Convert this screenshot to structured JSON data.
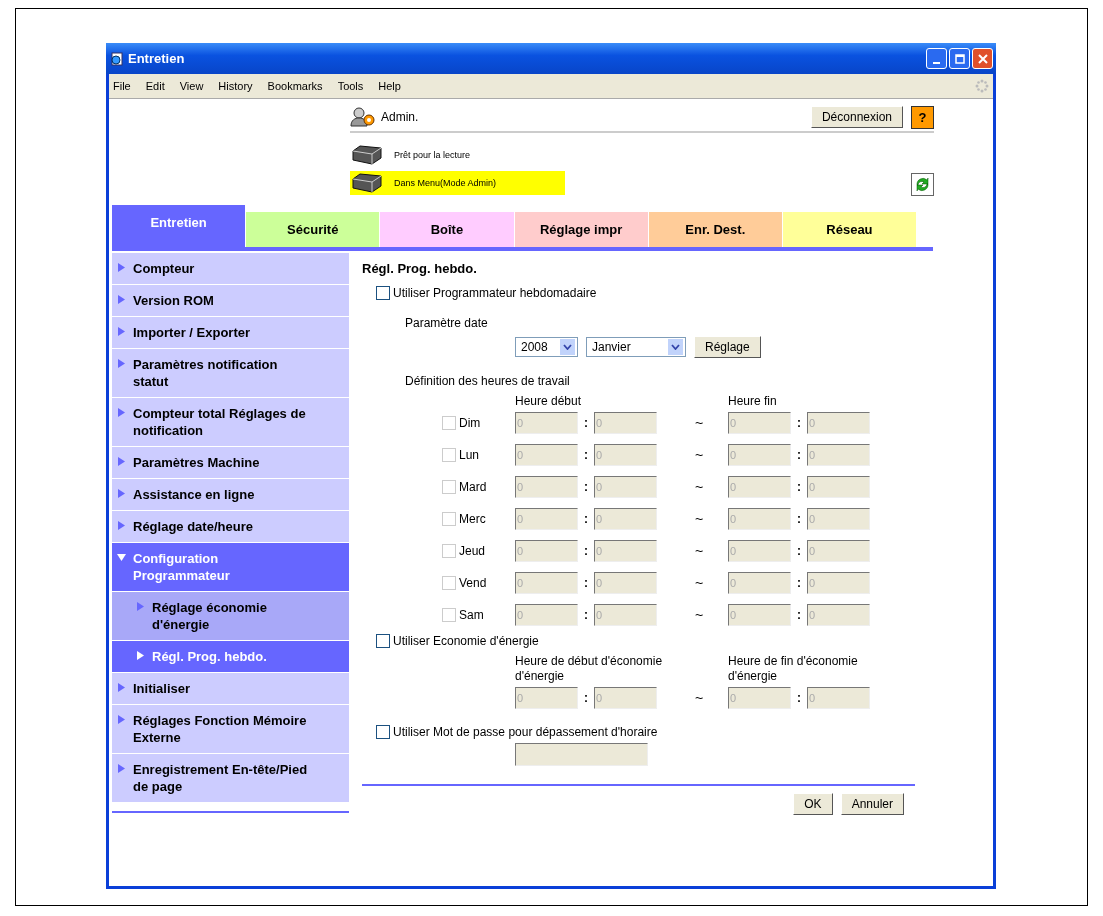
{
  "window": {
    "title": "Entretien"
  },
  "menu": [
    "File",
    "Edit",
    "View",
    "History",
    "Bookmarks",
    "Tools",
    "Help"
  ],
  "header": {
    "user": "Admin.",
    "logout": "Déconnexion",
    "help": "?",
    "status": [
      {
        "text": "Prêt pour la lecture",
        "highlighted": false
      },
      {
        "text": "Dans Menu(Mode Admin)",
        "highlighted": true
      }
    ]
  },
  "tabs": [
    {
      "label": "Entretien",
      "selected": true,
      "color": "#6666ff"
    },
    {
      "label": "Sécurité",
      "selected": false,
      "color": "#ccff99"
    },
    {
      "label": "Boîte",
      "selected": false,
      "color": "#ffccff"
    },
    {
      "label": "Réglage impr",
      "selected": false,
      "color": "#ffcccc"
    },
    {
      "label": "Enr. Dest.",
      "selected": false,
      "color": "#ffcc99"
    },
    {
      "label": "Réseau",
      "selected": false,
      "color": "#ffff99"
    }
  ],
  "sidebar": {
    "items": [
      {
        "label": "Compteur",
        "expanded": false
      },
      {
        "label": "Version ROM",
        "expanded": false
      },
      {
        "label": "Importer / Exporter",
        "expanded": false
      },
      {
        "label": "Paramètres notification statut",
        "expanded": false
      },
      {
        "label": "Compteur total Réglages de notification",
        "expanded": false
      },
      {
        "label": "Paramètres Machine",
        "expanded": false
      },
      {
        "label": "Assistance en ligne",
        "expanded": false
      },
      {
        "label": "Réglage date/heure",
        "expanded": false
      },
      {
        "label": "Configuration Programmateur",
        "expanded": true,
        "children": [
          {
            "label": "Réglage économie d'énergie",
            "selected": false
          },
          {
            "label": "Régl. Prog. hebdo.",
            "selected": true
          }
        ]
      },
      {
        "label": "Initialiser",
        "expanded": false
      },
      {
        "label": "Réglages Fonction Mémoire Externe",
        "expanded": false
      },
      {
        "label": "Enregistrement En-tête/Pied de page",
        "expanded": false
      }
    ]
  },
  "form": {
    "title": "Régl. Prog. hebdo.",
    "weekly": {
      "label": "Utiliser Programmateur hebdomadaire",
      "checked": false
    },
    "date": {
      "label": "Paramètre date",
      "year": "2008",
      "month": "Janvier",
      "button": "Réglage"
    },
    "hours": {
      "label": "Définition des heures de travail",
      "start_header": "Heure début",
      "end_header": "Heure fin",
      "rows": [
        {
          "day": "Dim",
          "checked": false,
          "disabled": true,
          "start_hour": "0",
          "start_minute": "0",
          "end_hour": "0",
          "end_minute": "0",
          "separators": [
            ":",
            "~",
            ":"
          ]
        },
        {
          "day": "Lun",
          "checked": false,
          "disabled": true,
          "start_hour": "0",
          "start_minute": "0",
          "end_hour": "0",
          "end_minute": "0",
          "separators": [
            ":",
            "~",
            ":"
          ]
        },
        {
          "day": "Mard",
          "checked": false,
          "disabled": true,
          "start_hour": "0",
          "start_minute": "0",
          "end_hour": "0",
          "end_minute": "0",
          "separators": [
            ":",
            "~",
            ":"
          ]
        },
        {
          "day": "Merc",
          "checked": false,
          "disabled": true,
          "start_hour": "0",
          "start_minute": "0",
          "end_hour": "0",
          "end_minute": "0",
          "separators": [
            ":",
            "~",
            ":"
          ]
        },
        {
          "day": "Jeud",
          "checked": false,
          "disabled": true,
          "start_hour": "0",
          "start_minute": "0",
          "end_hour": "0",
          "end_minute": "0",
          "separators": [
            ":",
            "~",
            ":"
          ]
        },
        {
          "day": "Vend",
          "checked": false,
          "disabled": true,
          "start_hour": "0",
          "start_minute": "0",
          "end_hour": "0",
          "end_minute": "0",
          "separators": [
            ":",
            "~",
            ":"
          ]
        },
        {
          "day": "Sam",
          "checked": false,
          "disabled": true,
          "start_hour": "0",
          "start_minute": "0",
          "end_hour": "0",
          "end_minute": "0",
          "separators": [
            ":",
            "~",
            ":"
          ]
        }
      ]
    },
    "energy": {
      "label": "Utiliser Economie d'énergie",
      "checked": false,
      "start_header": "Heure de début d'économie d'énergie",
      "end_header": "Heure de fin d'économie d'énergie",
      "disabled": true,
      "start_hour": "0",
      "start_minute": "0",
      "end_hour": "0",
      "end_minute": "0",
      "separators": [
        ":",
        "~",
        ":"
      ]
    },
    "password": {
      "label": "Utiliser Mot de passe pour dépassement d'horaire",
      "checked": false,
      "disabled": true
    },
    "buttons": [
      "OK",
      "Annuler"
    ]
  }
}
